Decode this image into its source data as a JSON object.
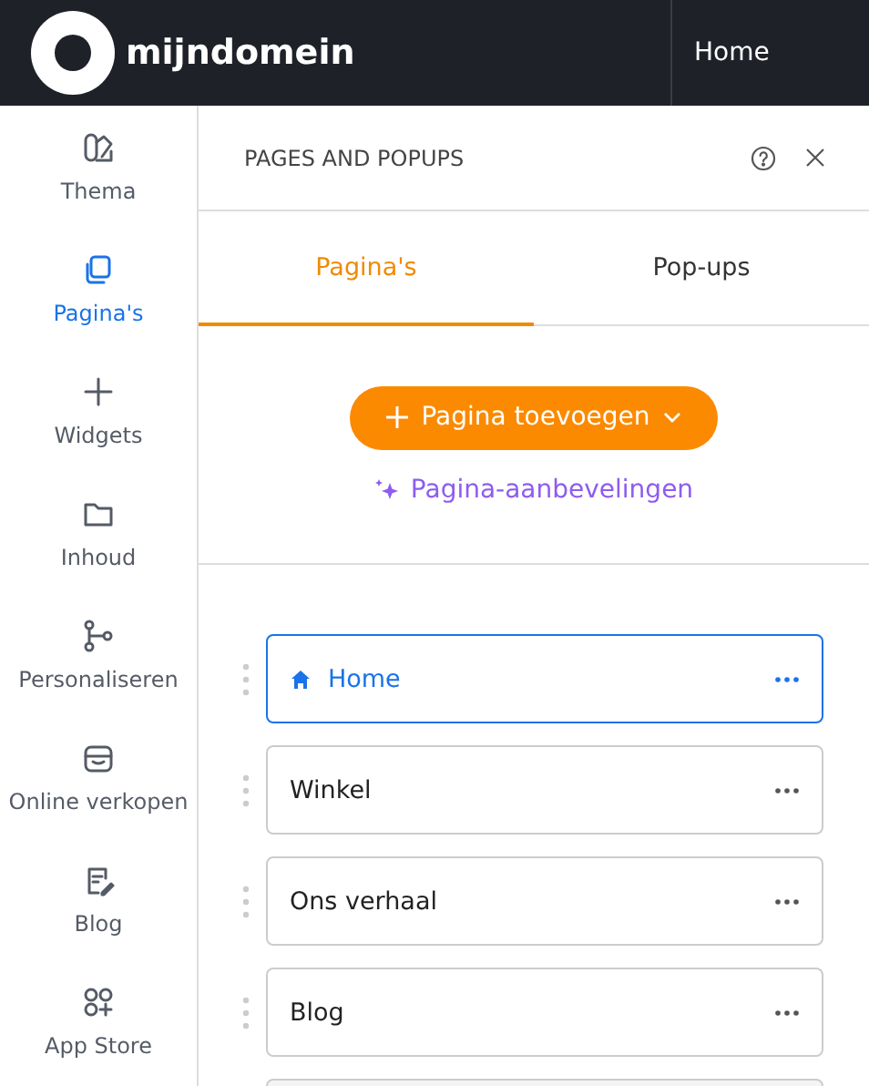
{
  "topbar": {
    "brand": "mijndomein",
    "page": "Home"
  },
  "sidebar": {
    "items": [
      {
        "label": "Thema",
        "selected": false
      },
      {
        "label": "Pagina's",
        "selected": true
      },
      {
        "label": "Widgets",
        "selected": false
      },
      {
        "label": "Inhoud",
        "selected": false
      },
      {
        "label": "Personaliseren",
        "selected": false
      },
      {
        "label": "Online verkopen",
        "selected": false
      },
      {
        "label": "Blog",
        "selected": false
      },
      {
        "label": "App Store",
        "selected": false
      }
    ]
  },
  "panel": {
    "title": "PAGES AND POPUPS",
    "tabs": [
      {
        "label": "Pagina's",
        "selected": true
      },
      {
        "label": "Pop-ups",
        "selected": false
      }
    ],
    "add_button": "Pagina toevoegen",
    "recommendations_link": "Pagina-aanbevelingen",
    "pages": [
      {
        "label": "Home",
        "selected": true,
        "home": true
      },
      {
        "label": "Winkel",
        "selected": false,
        "home": false
      },
      {
        "label": "Ons verhaal",
        "selected": false,
        "home": false
      },
      {
        "label": "Blog",
        "selected": false,
        "home": false
      }
    ]
  }
}
